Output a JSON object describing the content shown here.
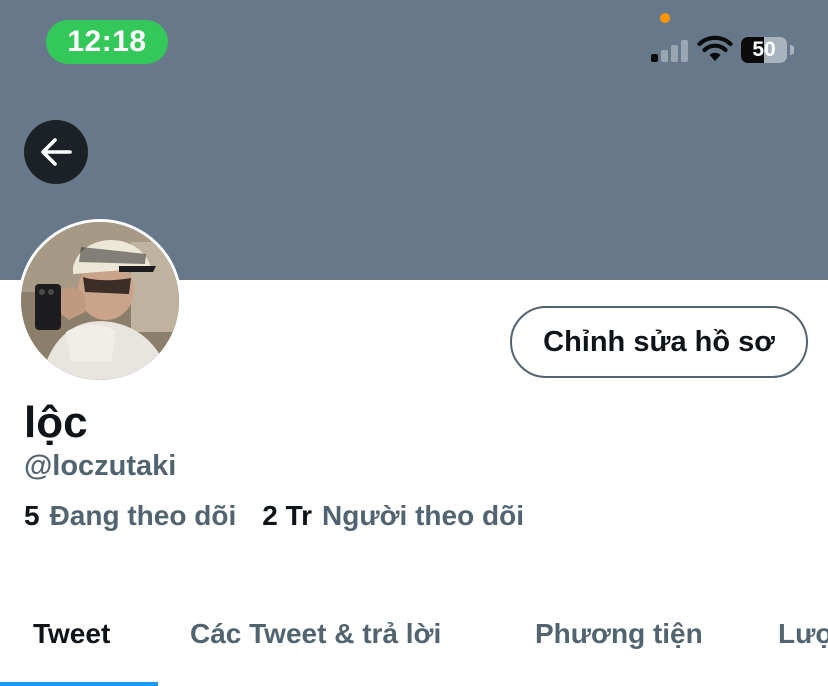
{
  "status_bar": {
    "time": "12:18",
    "battery": "50",
    "battery_level": 0.5,
    "signal_bars_active": 1,
    "signal_bars_total": 4,
    "time_pill_color": "#34c759",
    "privacy_dot_color": "#ff9500"
  },
  "header": {
    "banner_color": "#66788a",
    "back_icon": "arrow-left-icon"
  },
  "profile": {
    "display_name": "lộc",
    "handle": "@loczutaki",
    "edit_button": "Chỉnh sửa hồ sơ",
    "following_count": "5",
    "following_label": "Đang theo dõi",
    "followers_count": "2 Tr",
    "followers_label": "Người theo dõi"
  },
  "tabs": [
    {
      "label": "Tweet",
      "active": true
    },
    {
      "label": "Các Tweet & trả lời",
      "active": false
    },
    {
      "label": "Phương tiện",
      "active": false
    },
    {
      "label": "Lượt thích",
      "active": false
    }
  ],
  "accent_color": "#1d9bf0"
}
